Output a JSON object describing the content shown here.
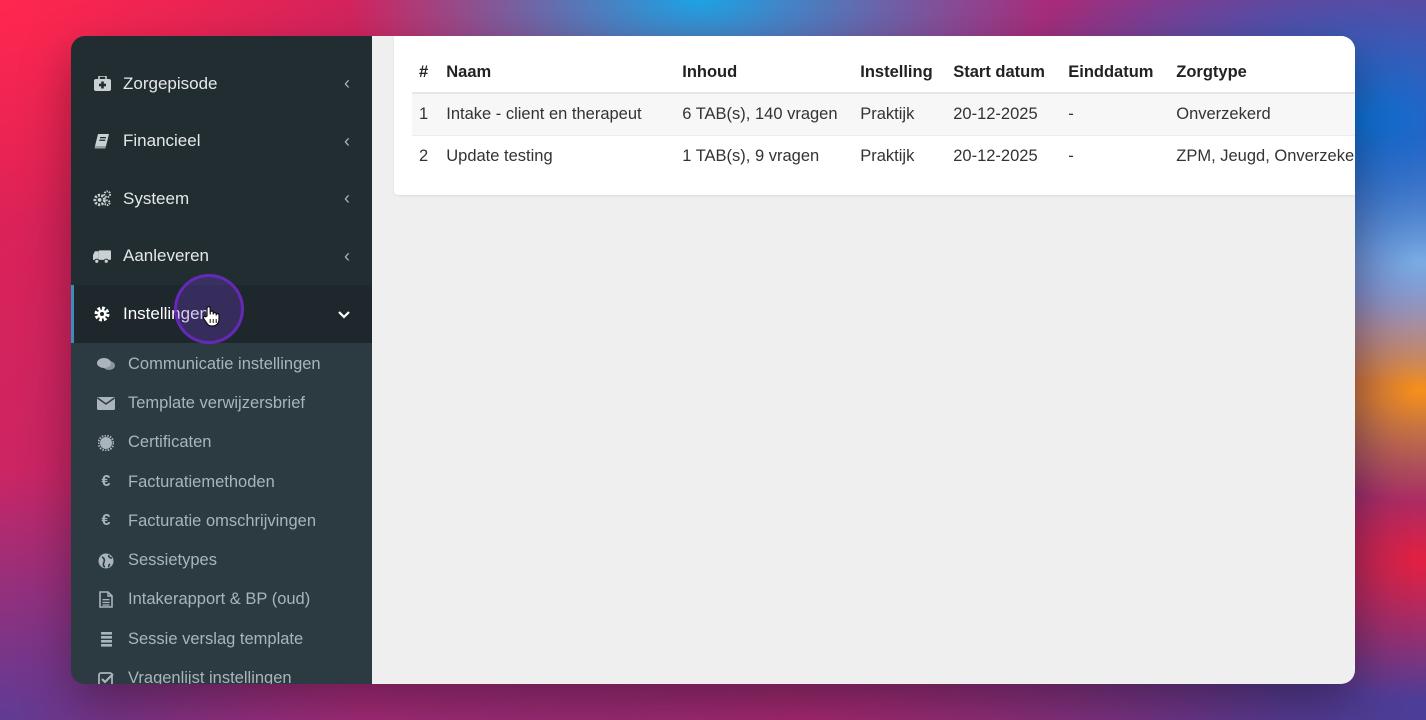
{
  "sidebar": {
    "items": [
      {
        "label": "Zorgepisode",
        "icon": "medkit-icon"
      },
      {
        "label": "Financieel",
        "icon": "book-icon"
      },
      {
        "label": "Systeem",
        "icon": "cogs-icon"
      },
      {
        "label": "Aanleveren",
        "icon": "truck-icon"
      },
      {
        "label": "Instellingen",
        "icon": "gear-icon"
      }
    ],
    "submenu": [
      {
        "label": "Communicatie instellingen",
        "icon": "comments-icon"
      },
      {
        "label": "Template verwijzersbrief",
        "icon": "envelope-icon"
      },
      {
        "label": "Certificaten",
        "icon": "certificate-icon"
      },
      {
        "label": "Facturatiemethoden",
        "icon": "euro-icon"
      },
      {
        "label": "Facturatie omschrijvingen",
        "icon": "euro-icon"
      },
      {
        "label": "Sessietypes",
        "icon": "globe-icon"
      },
      {
        "label": "Intakerapport & BP (oud)",
        "icon": "file-text-icon"
      },
      {
        "label": "Sessie verslag template",
        "icon": "list-icon"
      },
      {
        "label": "Vragenlijst instellingen",
        "icon": "check-square-icon"
      }
    ]
  },
  "table": {
    "headers": [
      "#",
      "Naam",
      "Inhoud",
      "Instelling",
      "Start datum",
      "Einddatum",
      "Zorgtype"
    ],
    "rows": [
      [
        "1",
        "Intake - client en therapeut",
        "6 TAB(s), 140 vragen",
        "Praktijk",
        "20-12-2025",
        "-",
        "Onverzekerd"
      ],
      [
        "2",
        "Update testing",
        "1 TAB(s), 9 vragen",
        "Praktijk",
        "20-12-2025",
        "-",
        "ZPM, Jeugd, Onverzekerd"
      ]
    ]
  },
  "colors": {
    "sidebar_bg": "#222d32",
    "submenu_bg": "#2c3b41",
    "accent": "#3c8dbc",
    "highlight": "#7a3cdc"
  }
}
